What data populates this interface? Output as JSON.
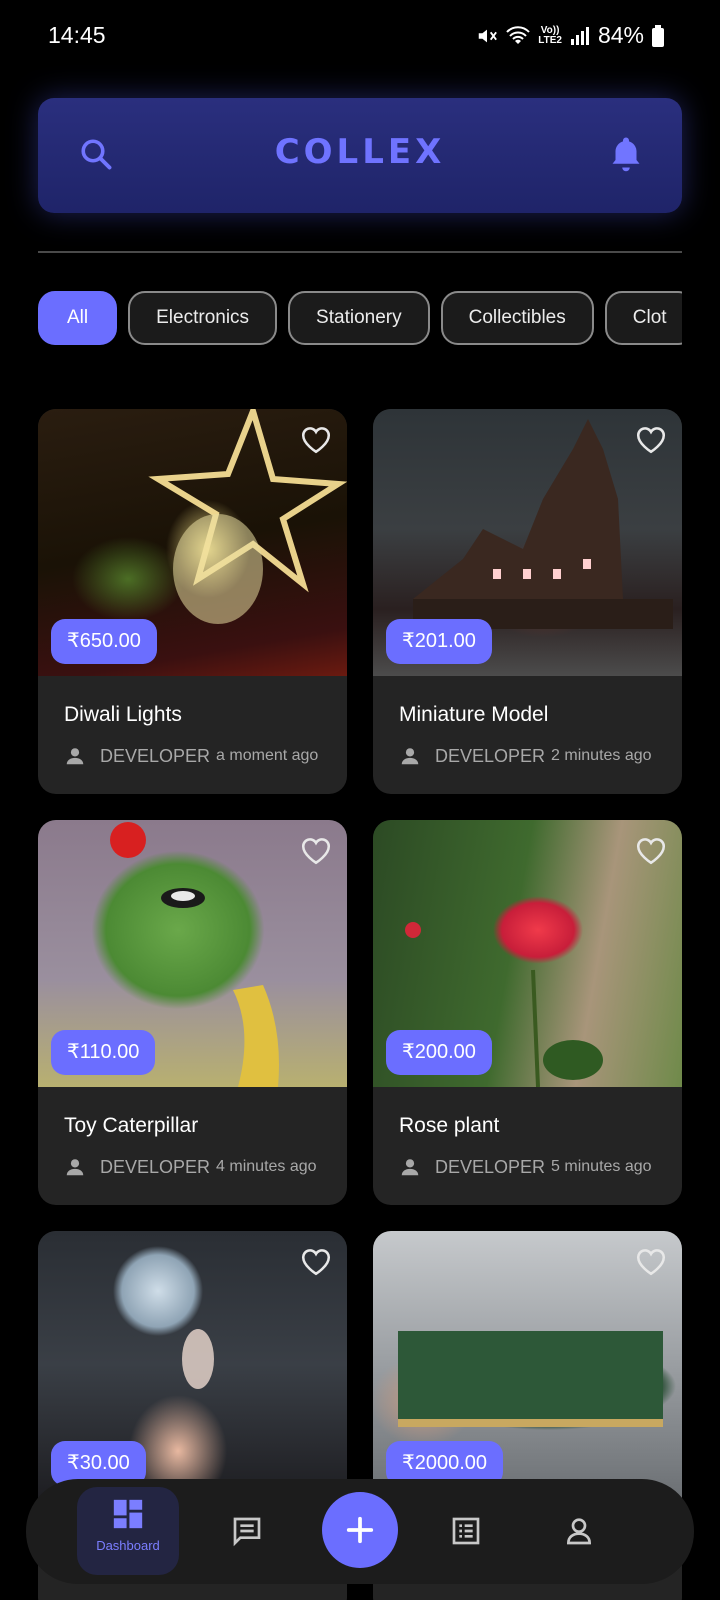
{
  "status_bar": {
    "time": "14:45",
    "battery": "84%",
    "network_label_top": "Vo))",
    "network_label_bottom": "LTE2"
  },
  "header": {
    "title": "COLLEX",
    "icons": [
      "search-icon",
      "bell-icon"
    ]
  },
  "categories": {
    "items": [
      "All",
      "Electronics",
      "Stationery",
      "Collectibles",
      "Clot"
    ],
    "selected": "All"
  },
  "products": [
    {
      "name": "Diwali Lights",
      "price": "₹650.00",
      "seller": "DEVELOPER",
      "posted": "a moment ago"
    },
    {
      "name": "Miniature Model",
      "price": "₹201.00",
      "seller": "DEVELOPER",
      "posted": "2 minutes ago"
    },
    {
      "name": "Toy Caterpillar",
      "price": "₹110.00",
      "seller": "DEVELOPER",
      "posted": "4 minutes ago"
    },
    {
      "name": "Rose plant",
      "price": "₹200.00",
      "seller": "DEVELOPER",
      "posted": "5 minutes ago"
    },
    {
      "price": "₹30.00"
    },
    {
      "price": "₹2000.00"
    }
  ],
  "bottom_nav": {
    "items": [
      {
        "label": "Dashboard",
        "icon": "dashboard-icon",
        "active": true
      },
      {
        "icon": "chat-icon"
      },
      {
        "icon": "add-icon"
      },
      {
        "icon": "list-icon"
      },
      {
        "icon": "profile-icon"
      }
    ]
  },
  "colors": {
    "accent": "#6b6eff",
    "background": "#000000",
    "card": "#242424"
  }
}
